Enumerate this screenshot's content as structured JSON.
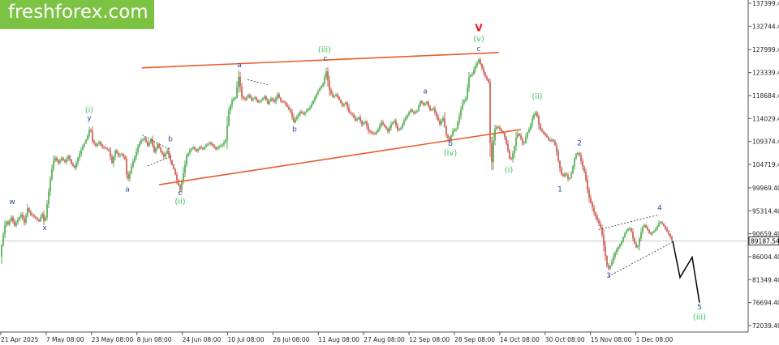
{
  "brand": {
    "name": "freshforex.com",
    "color": "#7cc243"
  },
  "price_marker": {
    "value": 89187.54,
    "label": "89187.54"
  },
  "colors": {
    "candle_up": "#2e9b2e",
    "candle_down": "#c0392b",
    "trendline": "#e85d2a",
    "wave_green": "#3cc45a",
    "wave_blue": "#2a4aa0",
    "wave_red": "#e21b1b",
    "forecast": "#000000"
  },
  "chart_data": {
    "type": "candlestick",
    "instrument_hint": "price chart with Elliott wave markup",
    "x_ticks": [
      "21 Apr 2025",
      "7 May 08:00",
      "23 May 08:00",
      "8 Jun 08:00",
      "24 Jun 08:00",
      "10 Jul 08:00",
      "26 Jul 08:00",
      "11 Aug 08:00",
      "27 Aug 08:00",
      "12 Sep 08:00",
      "28 Sep 08:00",
      "14 Oct 08:00",
      "30 Oct 08:00",
      "15 Nov 08:00",
      "1 Dec 08:00"
    ],
    "y_ticks": [
      "137399.40",
      "132744.40",
      "127999.40",
      "123339.40",
      "118684.40",
      "114029.40",
      "109374.40",
      "104719.40",
      "99969.40",
      "95314.40",
      "90659.40",
      "86004.40",
      "81349.40",
      "76694.40",
      "72039.40"
    ],
    "ylim": [
      72039.4,
      137399.4
    ],
    "price_path": [
      {
        "x": 0,
        "y": 86000
      },
      {
        "x": 3,
        "y": 89600
      },
      {
        "x": 7,
        "y": 93300
      },
      {
        "x": 10,
        "y": 92600
      },
      {
        "x": 14,
        "y": 94000
      },
      {
        "x": 18,
        "y": 92300
      },
      {
        "x": 22,
        "y": 93500
      },
      {
        "x": 26,
        "y": 94600
      },
      {
        "x": 30,
        "y": 92900
      },
      {
        "x": 34,
        "y": 95800
      },
      {
        "x": 38,
        "y": 94500
      },
      {
        "x": 41,
        "y": 94300
      },
      {
        "x": 44,
        "y": 93800
      },
      {
        "x": 48,
        "y": 93200
      },
      {
        "x": 52,
        "y": 94700
      },
      {
        "x": 55,
        "y": 92600
      },
      {
        "x": 59,
        "y": 98000
      },
      {
        "x": 63,
        "y": 103000
      },
      {
        "x": 67,
        "y": 106300
      },
      {
        "x": 72,
        "y": 105000
      },
      {
        "x": 76,
        "y": 106000
      },
      {
        "x": 80,
        "y": 105200
      },
      {
        "x": 84,
        "y": 106500
      },
      {
        "x": 88,
        "y": 104800
      },
      {
        "x": 92,
        "y": 104000
      },
      {
        "x": 96,
        "y": 106000
      },
      {
        "x": 100,
        "y": 107700
      },
      {
        "x": 104,
        "y": 109000
      },
      {
        "x": 108,
        "y": 110500
      },
      {
        "x": 111,
        "y": 112300
      },
      {
        "x": 114,
        "y": 109500
      },
      {
        "x": 118,
        "y": 108500
      },
      {
        "x": 122,
        "y": 109300
      },
      {
        "x": 126,
        "y": 108300
      },
      {
        "x": 130,
        "y": 108000
      },
      {
        "x": 134,
        "y": 107600
      },
      {
        "x": 138,
        "y": 105000
      },
      {
        "x": 142,
        "y": 107500
      },
      {
        "x": 146,
        "y": 106500
      },
      {
        "x": 150,
        "y": 106800
      },
      {
        "x": 154,
        "y": 105800
      },
      {
        "x": 157,
        "y": 101200
      },
      {
        "x": 162,
        "y": 104300
      },
      {
        "x": 166,
        "y": 106300
      },
      {
        "x": 170,
        "y": 108300
      },
      {
        "x": 174,
        "y": 109600
      },
      {
        "x": 178,
        "y": 110000
      },
      {
        "x": 182,
        "y": 108500
      },
      {
        "x": 186,
        "y": 109800
      },
      {
        "x": 190,
        "y": 107200
      },
      {
        "x": 194,
        "y": 108800
      },
      {
        "x": 198,
        "y": 107400
      },
      {
        "x": 202,
        "y": 106300
      },
      {
        "x": 206,
        "y": 107500
      },
      {
        "x": 210,
        "y": 105500
      },
      {
        "x": 214,
        "y": 103800
      },
      {
        "x": 218,
        "y": 101500
      },
      {
        "x": 222,
        "y": 99500
      },
      {
        "x": 226,
        "y": 103000
      },
      {
        "x": 230,
        "y": 106400
      },
      {
        "x": 234,
        "y": 107600
      },
      {
        "x": 238,
        "y": 108200
      },
      {
        "x": 242,
        "y": 107400
      },
      {
        "x": 246,
        "y": 108200
      },
      {
        "x": 250,
        "y": 107800
      },
      {
        "x": 254,
        "y": 108700
      },
      {
        "x": 258,
        "y": 109100
      },
      {
        "x": 262,
        "y": 108600
      },
      {
        "x": 266,
        "y": 107800
      },
      {
        "x": 270,
        "y": 108400
      },
      {
        "x": 274,
        "y": 108700
      },
      {
        "x": 278,
        "y": 109700
      },
      {
        "x": 282,
        "y": 115600
      },
      {
        "x": 286,
        "y": 117700
      },
      {
        "x": 290,
        "y": 118300
      },
      {
        "x": 294,
        "y": 122500
      },
      {
        "x": 298,
        "y": 118400
      },
      {
        "x": 302,
        "y": 117800
      },
      {
        "x": 306,
        "y": 118800
      },
      {
        "x": 310,
        "y": 117800
      },
      {
        "x": 314,
        "y": 118300
      },
      {
        "x": 318,
        "y": 117300
      },
      {
        "x": 322,
        "y": 117800
      },
      {
        "x": 326,
        "y": 118500
      },
      {
        "x": 330,
        "y": 117000
      },
      {
        "x": 334,
        "y": 118100
      },
      {
        "x": 338,
        "y": 117400
      },
      {
        "x": 342,
        "y": 118900
      },
      {
        "x": 346,
        "y": 117600
      },
      {
        "x": 350,
        "y": 117300
      },
      {
        "x": 354,
        "y": 116400
      },
      {
        "x": 358,
        "y": 115300
      },
      {
        "x": 362,
        "y": 113300
      },
      {
        "x": 366,
        "y": 114400
      },
      {
        "x": 370,
        "y": 115400
      },
      {
        "x": 374,
        "y": 114900
      },
      {
        "x": 378,
        "y": 115700
      },
      {
        "x": 382,
        "y": 116300
      },
      {
        "x": 386,
        "y": 117600
      },
      {
        "x": 390,
        "y": 119000
      },
      {
        "x": 394,
        "y": 120200
      },
      {
        "x": 398,
        "y": 121100
      },
      {
        "x": 402,
        "y": 123600
      },
      {
        "x": 406,
        "y": 119800
      },
      {
        "x": 410,
        "y": 118400
      },
      {
        "x": 414,
        "y": 118900
      },
      {
        "x": 418,
        "y": 117800
      },
      {
        "x": 422,
        "y": 116600
      },
      {
        "x": 426,
        "y": 117300
      },
      {
        "x": 430,
        "y": 115300
      },
      {
        "x": 434,
        "y": 114800
      },
      {
        "x": 438,
        "y": 113600
      },
      {
        "x": 442,
        "y": 114300
      },
      {
        "x": 446,
        "y": 112800
      },
      {
        "x": 450,
        "y": 113400
      },
      {
        "x": 454,
        "y": 111500
      },
      {
        "x": 458,
        "y": 111100
      },
      {
        "x": 462,
        "y": 110900
      },
      {
        "x": 466,
        "y": 111800
      },
      {
        "x": 470,
        "y": 113300
      },
      {
        "x": 474,
        "y": 112400
      },
      {
        "x": 478,
        "y": 111400
      },
      {
        "x": 482,
        "y": 112900
      },
      {
        "x": 486,
        "y": 113600
      },
      {
        "x": 490,
        "y": 111700
      },
      {
        "x": 494,
        "y": 112100
      },
      {
        "x": 498,
        "y": 113700
      },
      {
        "x": 502,
        "y": 114700
      },
      {
        "x": 506,
        "y": 115800
      },
      {
        "x": 510,
        "y": 115100
      },
      {
        "x": 514,
        "y": 115600
      },
      {
        "x": 518,
        "y": 117500
      },
      {
        "x": 522,
        "y": 116800
      },
      {
        "x": 526,
        "y": 117400
      },
      {
        "x": 530,
        "y": 115700
      },
      {
        "x": 534,
        "y": 116100
      },
      {
        "x": 538,
        "y": 114400
      },
      {
        "x": 542,
        "y": 112900
      },
      {
        "x": 546,
        "y": 114100
      },
      {
        "x": 550,
        "y": 110600
      },
      {
        "x": 554,
        "y": 109600
      },
      {
        "x": 558,
        "y": 111500
      },
      {
        "x": 562,
        "y": 111900
      },
      {
        "x": 566,
        "y": 114500
      },
      {
        "x": 570,
        "y": 117200
      },
      {
        "x": 574,
        "y": 118100
      },
      {
        "x": 578,
        "y": 122500
      },
      {
        "x": 582,
        "y": 123100
      },
      {
        "x": 586,
        "y": 124700
      },
      {
        "x": 590,
        "y": 126000
      },
      {
        "x": 594,
        "y": 124200
      },
      {
        "x": 598,
        "y": 122500
      },
      {
        "x": 602,
        "y": 121400
      },
      {
        "x": 605,
        "y": 103000
      },
      {
        "x": 609,
        "y": 111800
      },
      {
        "x": 613,
        "y": 112500
      },
      {
        "x": 617,
        "y": 111600
      },
      {
        "x": 621,
        "y": 110900
      },
      {
        "x": 625,
        "y": 108200
      },
      {
        "x": 629,
        "y": 105200
      },
      {
        "x": 633,
        "y": 107500
      },
      {
        "x": 637,
        "y": 111100
      },
      {
        "x": 641,
        "y": 110400
      },
      {
        "x": 645,
        "y": 108500
      },
      {
        "x": 649,
        "y": 110900
      },
      {
        "x": 653,
        "y": 112200
      },
      {
        "x": 657,
        "y": 114600
      },
      {
        "x": 661,
        "y": 115400
      },
      {
        "x": 665,
        "y": 112000
      },
      {
        "x": 669,
        "y": 111200
      },
      {
        "x": 673,
        "y": 110500
      },
      {
        "x": 677,
        "y": 109400
      },
      {
        "x": 681,
        "y": 109800
      },
      {
        "x": 685,
        "y": 108200
      },
      {
        "x": 689,
        "y": 104500
      },
      {
        "x": 693,
        "y": 102100
      },
      {
        "x": 697,
        "y": 103000
      },
      {
        "x": 701,
        "y": 101400
      },
      {
        "x": 705,
        "y": 103500
      },
      {
        "x": 709,
        "y": 106800
      },
      {
        "x": 713,
        "y": 107100
      },
      {
        "x": 717,
        "y": 104800
      },
      {
        "x": 721,
        "y": 102700
      },
      {
        "x": 725,
        "y": 98400
      },
      {
        "x": 729,
        "y": 96500
      },
      {
        "x": 733,
        "y": 94500
      },
      {
        "x": 737,
        "y": 93100
      },
      {
        "x": 741,
        "y": 91500
      },
      {
        "x": 745,
        "y": 87100
      },
      {
        "x": 749,
        "y": 83300
      },
      {
        "x": 753,
        "y": 84500
      },
      {
        "x": 757,
        "y": 86500
      },
      {
        "x": 761,
        "y": 87700
      },
      {
        "x": 765,
        "y": 88700
      },
      {
        "x": 769,
        "y": 90400
      },
      {
        "x": 773,
        "y": 91600
      },
      {
        "x": 777,
        "y": 91800
      },
      {
        "x": 781,
        "y": 89100
      },
      {
        "x": 785,
        "y": 87500
      },
      {
        "x": 789,
        "y": 90400
      },
      {
        "x": 793,
        "y": 92600
      },
      {
        "x": 797,
        "y": 91800
      },
      {
        "x": 801,
        "y": 90500
      },
      {
        "x": 805,
        "y": 91100
      },
      {
        "x": 809,
        "y": 91800
      },
      {
        "x": 813,
        "y": 93200
      },
      {
        "x": 817,
        "y": 92500
      },
      {
        "x": 821,
        "y": 91400
      },
      {
        "x": 825,
        "y": 90300
      },
      {
        "x": 829,
        "y": 89200
      }
    ],
    "forecast_path": [
      {
        "x": 829,
        "y": 89200
      },
      {
        "x": 838,
        "y": 81800
      },
      {
        "x": 853,
        "y": 85900
      },
      {
        "x": 862,
        "y": 76700
      }
    ],
    "trendlines": [
      {
        "id": "upper-channel",
        "from": {
          "x": 175,
          "y": 124300
        },
        "to": {
          "x": 615,
          "y": 127400
        }
      },
      {
        "id": "lower-channel",
        "from": {
          "x": 196,
          "y": 100600
        },
        "to": {
          "x": 642,
          "y": 111800
        }
      }
    ],
    "wave_labels": [
      {
        "text": "w",
        "x": 15,
        "y": 96700,
        "color": "blue"
      },
      {
        "text": "x",
        "x": 55,
        "y": 91400,
        "color": "blue"
      },
      {
        "text": "(i)",
        "x": 110,
        "y": 115200,
        "color": "green"
      },
      {
        "text": "y",
        "x": 110,
        "y": 113700,
        "color": "blue"
      },
      {
        "text": "a",
        "x": 157,
        "y": 99200,
        "color": "blue"
      },
      {
        "text": "b",
        "x": 210,
        "y": 109400,
        "color": "blue"
      },
      {
        "text": "c",
        "x": 222,
        "y": 98500,
        "color": "blue"
      },
      {
        "text": "(ii)",
        "x": 222,
        "y": 96700,
        "color": "green"
      },
      {
        "text": "a",
        "x": 295,
        "y": 124400,
        "color": "blue"
      },
      {
        "text": "b",
        "x": 363,
        "y": 111400,
        "color": "blue"
      },
      {
        "text": "(iii)",
        "x": 400,
        "y": 127500,
        "color": "green"
      },
      {
        "text": "c",
        "x": 401,
        "y": 125700,
        "color": "blue"
      },
      {
        "text": "a",
        "x": 524,
        "y": 119100,
        "color": "blue"
      },
      {
        "text": "b",
        "x": 555,
        "y": 108500,
        "color": "blue"
      },
      {
        "text": "(iv)",
        "x": 555,
        "y": 106500,
        "color": "green"
      },
      {
        "text": "V",
        "x": 590,
        "y": 131700,
        "color": "red"
      },
      {
        "text": "(v)",
        "x": 590,
        "y": 129700,
        "color": "green"
      },
      {
        "text": "c",
        "x": 590,
        "y": 127700,
        "color": "blue"
      },
      {
        "text": "(i)",
        "x": 627,
        "y": 103100,
        "color": "green"
      },
      {
        "text": "(ii)",
        "x": 662,
        "y": 117900,
        "color": "green"
      },
      {
        "text": "1",
        "x": 690,
        "y": 99200,
        "color": "blue"
      },
      {
        "text": "2",
        "x": 714,
        "y": 108600,
        "color": "blue"
      },
      {
        "text": "3",
        "x": 750,
        "y": 81700,
        "color": "blue"
      },
      {
        "text": "4",
        "x": 813,
        "y": 95400,
        "color": "blue"
      },
      {
        "text": "5",
        "x": 862,
        "y": 75300,
        "color": "blue"
      },
      {
        "text": "(iii)",
        "x": 862,
        "y": 73300,
        "color": "green"
      }
    ],
    "dotted_segments": [
      [
        {
          "x": 175,
          "y": 110700
        },
        {
          "x": 210,
          "y": 107700
        }
      ],
      [
        {
          "x": 182,
          "y": 104400
        },
        {
          "x": 212,
          "y": 106400
        }
      ],
      [
        {
          "x": 305,
          "y": 121900
        },
        {
          "x": 330,
          "y": 120900
        }
      ],
      [
        {
          "x": 738,
          "y": 91500
        },
        {
          "x": 812,
          "y": 94500
        }
      ],
      [
        {
          "x": 750,
          "y": 82000
        },
        {
          "x": 830,
          "y": 89100
        }
      ]
    ],
    "grid": false
  }
}
